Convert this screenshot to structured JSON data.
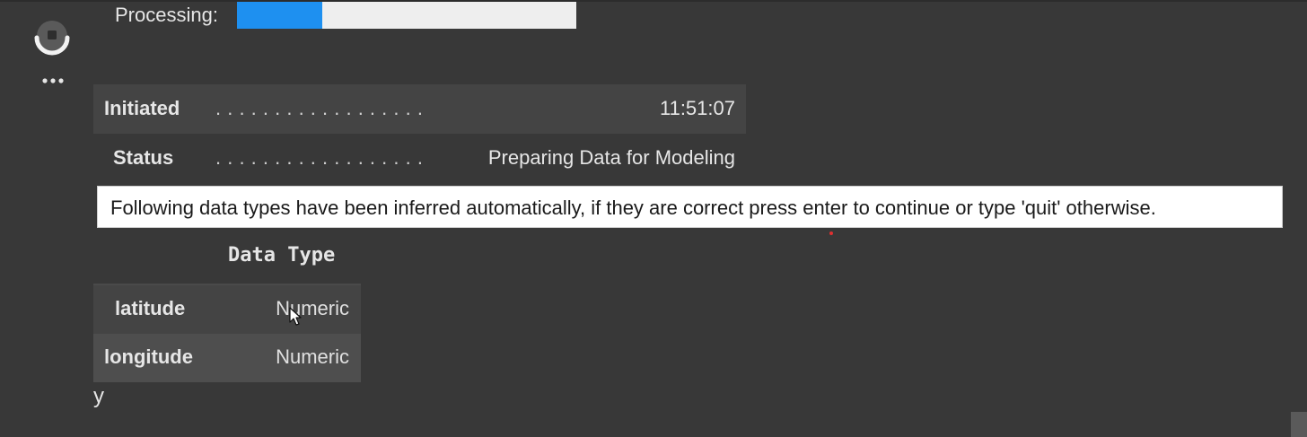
{
  "cell": {
    "run_icon": "stop-circle-icon",
    "more_icon": "more-horizontal-icon"
  },
  "progress": {
    "label": "Processing:",
    "fraction": 0.25,
    "fill_color": "#1e90f0",
    "track_color": "#eeeeee"
  },
  "info": {
    "rows": [
      {
        "key": "Initiated",
        "dots": ". . . . . . . . . . . . . . . . . .",
        "value": "11:51:07"
      },
      {
        "key": "Status",
        "dots": ". . . . . . . . . . . . . . . . . .",
        "value": "Preparing Data for Modeling"
      }
    ]
  },
  "message": {
    "text": "Following data types have been inferred automatically, if they are correct press enter to continue or type 'quit' otherwise."
  },
  "dtypes": {
    "header": "Data Type",
    "rows": [
      {
        "name": "latitude",
        "type": "Numeric"
      },
      {
        "name": "longitude",
        "type": "Numeric"
      }
    ]
  },
  "input": {
    "value": "y"
  }
}
